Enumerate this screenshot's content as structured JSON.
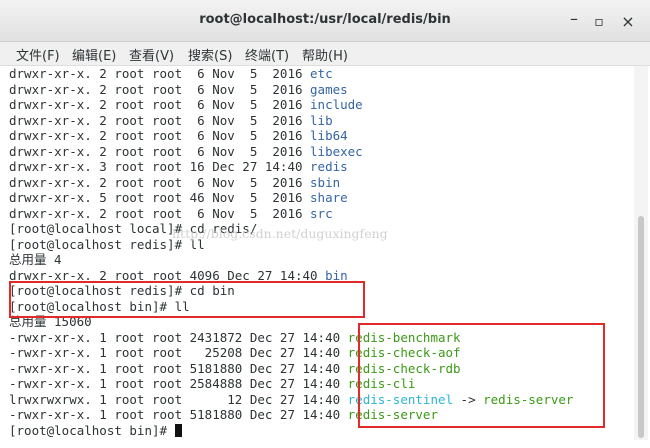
{
  "window": {
    "title": "root@localhost:/usr/local/redis/bin",
    "minimize": "–",
    "maximize": "▫",
    "close": "×"
  },
  "menu": [
    "文件(F)",
    "编辑(E)",
    "查看(V)",
    "搜索(S)",
    "终端(T)",
    "帮助(H)"
  ],
  "listing1": [
    {
      "meta": "drwxr-xr-x. 2 root root  6 Nov  5  2016 ",
      "name": "etc"
    },
    {
      "meta": "drwxr-xr-x. 2 root root  6 Nov  5  2016 ",
      "name": "games"
    },
    {
      "meta": "drwxr-xr-x. 2 root root  6 Nov  5  2016 ",
      "name": "include"
    },
    {
      "meta": "drwxr-xr-x. 2 root root  6 Nov  5  2016 ",
      "name": "lib"
    },
    {
      "meta": "drwxr-xr-x. 2 root root  6 Nov  5  2016 ",
      "name": "lib64"
    },
    {
      "meta": "drwxr-xr-x. 2 root root  6 Nov  5  2016 ",
      "name": "libexec"
    },
    {
      "meta": "drwxr-xr-x. 3 root root 16 Dec 27 14:40 ",
      "name": "redis"
    },
    {
      "meta": "drwxr-xr-x. 2 root root  6 Nov  5  2016 ",
      "name": "sbin"
    },
    {
      "meta": "drwxr-xr-x. 5 root root 46 Nov  5  2016 ",
      "name": "share"
    },
    {
      "meta": "drwxr-xr-x. 2 root root  6 Nov  5  2016 ",
      "name": "src"
    }
  ],
  "cmd1": "[root@localhost local]# cd redis/",
  "cmd2": "[root@localhost redis]# ll",
  "total1": "总用量 4",
  "bin_row": {
    "meta": "drwxr-xr-x. 2 root root 4096 Dec 27 14:40 ",
    "name": "bin"
  },
  "cmd3": "[root@localhost redis]# cd bin",
  "cmd4": "[root@localhost bin]# ll",
  "total2": "总用量 15060",
  "listing2": [
    {
      "meta": "-rwxr-xr-x. 1 root root 2431872 Dec 27 14:40 ",
      "name": "redis-benchmark",
      "color": "green"
    },
    {
      "meta": "-rwxr-xr-x. 1 root root   25208 Dec 27 14:40 ",
      "name": "redis-check-aof",
      "color": "green"
    },
    {
      "meta": "-rwxr-xr-x. 1 root root 5181880 Dec 27 14:40 ",
      "name": "redis-check-rdb",
      "color": "green"
    },
    {
      "meta": "-rwxr-xr-x. 1 root root 2584888 Dec 27 14:40 ",
      "name": "redis-cli",
      "color": "green"
    },
    {
      "meta": "lrwxrwxrwx. 1 root root      12 Dec 27 14:40 ",
      "name": "redis-sentinel",
      "color": "cyan",
      "arrow": " -> ",
      "target": "redis-server"
    },
    {
      "meta": "-rwxr-xr-x. 1 root root 5181880 Dec 27 14:40 ",
      "name": "redis-server",
      "color": "green"
    }
  ],
  "prompt": "[root@localhost bin]# ",
  "watermark": "http://blog.csdn.net/duguxingfeng",
  "colors": {
    "dir": "#3465a4",
    "exec": "#3b9a16",
    "link": "#2bb5d6",
    "highlight": "#e12b2b"
  }
}
